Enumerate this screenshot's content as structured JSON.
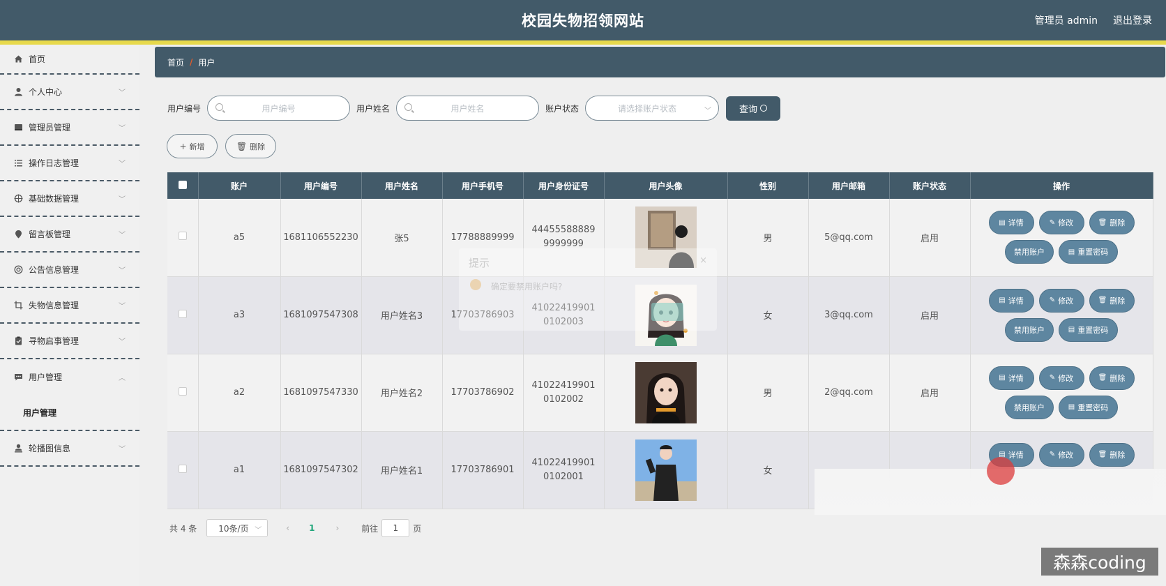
{
  "header": {
    "title": "校园失物招领网站",
    "admin_text": "管理员 admin",
    "logout": "退出登录"
  },
  "sidebar": {
    "items": [
      {
        "label": "首页",
        "icon": "home-icon",
        "arrow": false
      },
      {
        "label": "个人中心",
        "icon": "user-icon",
        "arrow": true
      },
      {
        "label": "管理员管理",
        "icon": "folder-icon",
        "arrow": true
      },
      {
        "label": "操作日志管理",
        "icon": "list-icon",
        "arrow": true
      },
      {
        "label": "基础数据管理",
        "icon": "target-icon",
        "arrow": true
      },
      {
        "label": "留言板管理",
        "icon": "pin-icon",
        "arrow": true
      },
      {
        "label": "公告信息管理",
        "icon": "lifebuoy-icon",
        "arrow": true
      },
      {
        "label": "失物信息管理",
        "icon": "crop-icon",
        "arrow": true
      },
      {
        "label": "寻物启事管理",
        "icon": "clipboard-icon",
        "arrow": true
      },
      {
        "label": "用户管理",
        "icon": "chat-icon",
        "arrow": true,
        "expanded": true
      },
      {
        "label": "轮播图信息",
        "icon": "user-stand-icon",
        "arrow": true
      }
    ],
    "submenu_label": "用户管理"
  },
  "breadcrumb": {
    "home": "首页",
    "sep": "/",
    "current": "用户"
  },
  "search": {
    "label_code": "用户编号",
    "placeholder_code": "用户编号",
    "label_name": "用户姓名",
    "placeholder_name": "用户姓名",
    "label_status": "账户状态",
    "placeholder_status": "请选择账户状态",
    "query_button": "查询"
  },
  "actions": {
    "add": "新增",
    "delete": "删除"
  },
  "table": {
    "headers": [
      "账户",
      "用户编号",
      "用户姓名",
      "用户手机号",
      "用户身份证号",
      "用户头像",
      "性别",
      "用户邮箱",
      "账户状态",
      "操作"
    ],
    "rows": [
      {
        "account": "a5",
        "code": "1681106552230",
        "name": "张5",
        "phone": "17788889999",
        "id_card": "444555888899999999",
        "gender": "男",
        "email": "5@qq.com",
        "status": "启用"
      },
      {
        "account": "a3",
        "code": "1681097547308",
        "name": "用户姓名3",
        "phone": "17703786903",
        "id_card": "410224199010102003",
        "gender": "女",
        "email": "3@qq.com",
        "status": "启用"
      },
      {
        "account": "a2",
        "code": "1681097547330",
        "name": "用户姓名2",
        "phone": "17703786902",
        "id_card": "410224199010102002",
        "gender": "男",
        "email": "2@qq.com",
        "status": "启用"
      },
      {
        "account": "a1",
        "code": "1681097547302",
        "name": "用户姓名1",
        "phone": "17703786901",
        "id_card": "410224199010102001",
        "gender": "女",
        "email": "",
        "status": ""
      }
    ],
    "ops": {
      "detail": "详情",
      "edit": "修改",
      "delete": "删除",
      "disable": "禁用账户",
      "reset": "重置密码"
    }
  },
  "pager": {
    "total": "共 4 条",
    "page_size": "10条/页",
    "current": "1",
    "goto": "前往",
    "goto_value": "1",
    "page_unit": "页"
  },
  "dialog_ghost": {
    "title": "提示",
    "message": "确定要禁用账户吗?",
    "close": "×"
  },
  "watermark": "森森coding",
  "colors": {
    "header_bg": "#425a69",
    "accent_yellow": "#e7d94c",
    "op_button": "#5e86a0"
  }
}
